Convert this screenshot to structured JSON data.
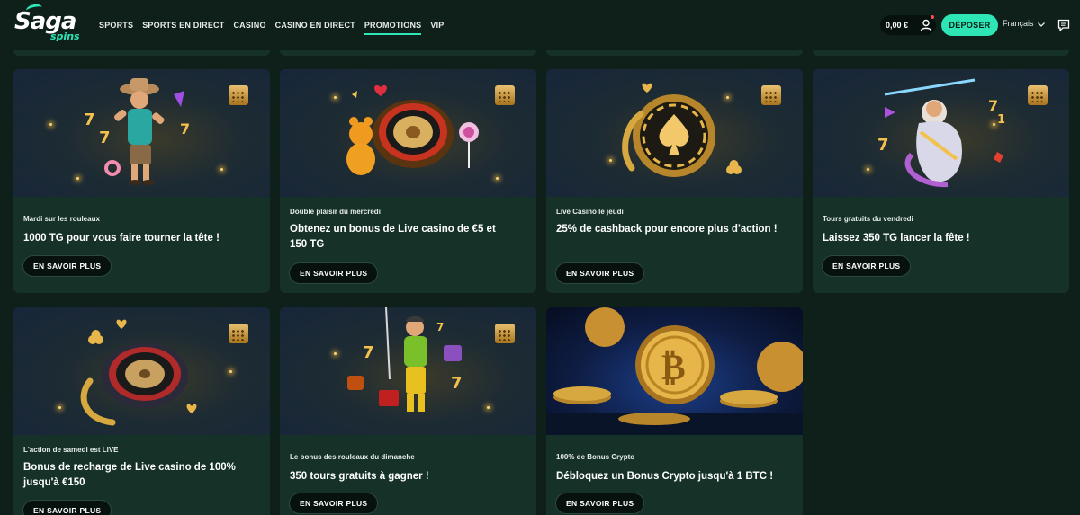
{
  "brand": {
    "name": "Saga",
    "sub": "spins"
  },
  "nav": [
    {
      "label": "SPORTS",
      "active": false
    },
    {
      "label": "SPORTS EN DIRECT",
      "active": false
    },
    {
      "label": "CASINO",
      "active": false
    },
    {
      "label": "CASINO EN DIRECT",
      "active": false
    },
    {
      "label": "PROMOTIONS",
      "active": true
    },
    {
      "label": "VIP",
      "active": false
    }
  ],
  "header": {
    "balance": "0,00 €",
    "deposit_label": "DÉPOSER",
    "language": "Français"
  },
  "icons": {
    "calendar": "calendar-icon",
    "user": "user-icon",
    "chat": "chat-icon",
    "chevron": "chevron-down-icon"
  },
  "colors": {
    "accent": "#2ee6b5",
    "background": "#0f1f19",
    "card": "#163228"
  },
  "promotions": [
    {
      "subtitle": "Mardi sur les rouleaux",
      "title": "1000 TG pour vous faire tourner la tête !",
      "button": "EN SAVOIR PLUS",
      "image": "cowboy-character"
    },
    {
      "subtitle": "Double plaisir du mercredi",
      "title": "Obtenez un bonus de Live casino de €5 et 150 TG",
      "button": "EN SAVOIR PLUS",
      "image": "roulette-gummy-bear"
    },
    {
      "subtitle": "Live Casino le jeudi",
      "title": "25% de cashback pour encore plus d'action !",
      "button": "EN SAVOIR PLUS",
      "image": "poker-chip-spade"
    },
    {
      "subtitle": "Tours gratuits du vendredi",
      "title": "Laissez 350 TG lancer la fête !",
      "button": "EN SAVOIR PLUS",
      "image": "zeus-character"
    },
    {
      "subtitle": "L'action de samedi est LIVE",
      "title": "Bonus de recharge de Live casino de 100% jusqu'à €150",
      "button": "EN SAVOIR PLUS",
      "image": "roulette-wheel"
    },
    {
      "subtitle": "Le bonus des rouleaux du dimanche",
      "title": "350 tours gratuits à gagner !",
      "button": "EN SAVOIR PLUS",
      "image": "miner-character"
    },
    {
      "subtitle": "100% de Bonus Crypto",
      "title": "Débloquez un Bonus Crypto jusqu'à 1 BTC !",
      "button": "EN SAVOIR PLUS",
      "image": "bitcoin-coins"
    }
  ]
}
